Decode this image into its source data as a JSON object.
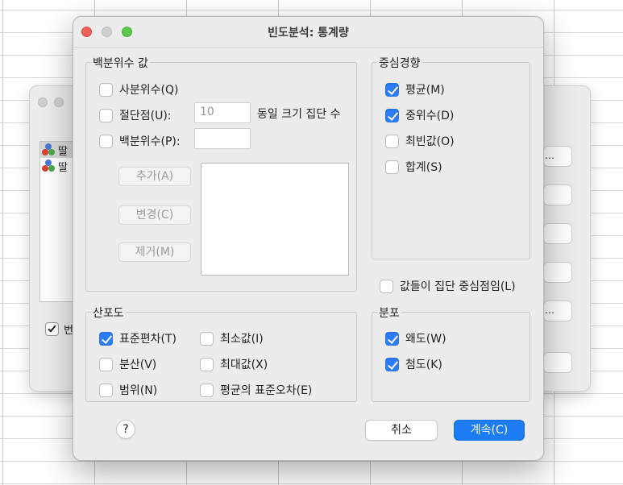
{
  "background_dialog": {
    "variables": [
      "딸",
      "딸"
    ],
    "checkbox_label": "번",
    "buttons": [
      "…",
      "",
      "",
      "",
      "…",
      ""
    ]
  },
  "dialog": {
    "title": "빈도분석: 통계량",
    "percentile": {
      "legend": "백분위수 값",
      "quartiles": "사분위수(Q)",
      "cut_points": "절단점(U):",
      "cut_points_value": "10",
      "cut_points_suffix": "동일 크기 집단 수",
      "percentiles": "백분위수(P):",
      "percentiles_value": "",
      "add": "추가(A)",
      "change": "변경(C)",
      "remove": "제거(M)"
    },
    "central_tendency": {
      "legend": "중심경향",
      "mean": "평균(M)",
      "median": "중위수(D)",
      "mode": "최빈값(O)",
      "sum": "합계(S)"
    },
    "group_midpoints": "값들이 집단 중심점임(L)",
    "dispersion": {
      "legend": "산포도",
      "std_dev": "표준편차(T)",
      "minimum": "최소값(I)",
      "variance": "분산(V)",
      "maximum": "최대값(X)",
      "range": "범위(N)",
      "se_mean": "평균의 표준오차(E)"
    },
    "distribution": {
      "legend": "분포",
      "skewness": "왜도(W)",
      "kurtosis": "첨도(K)"
    },
    "help": "?",
    "cancel": "취소",
    "continue": "계속(C)"
  },
  "colors": {
    "accent": "#1b7cf3",
    "close": "#ee5f57",
    "minimize": "#f5be4f",
    "zoom": "#5cc84b"
  }
}
